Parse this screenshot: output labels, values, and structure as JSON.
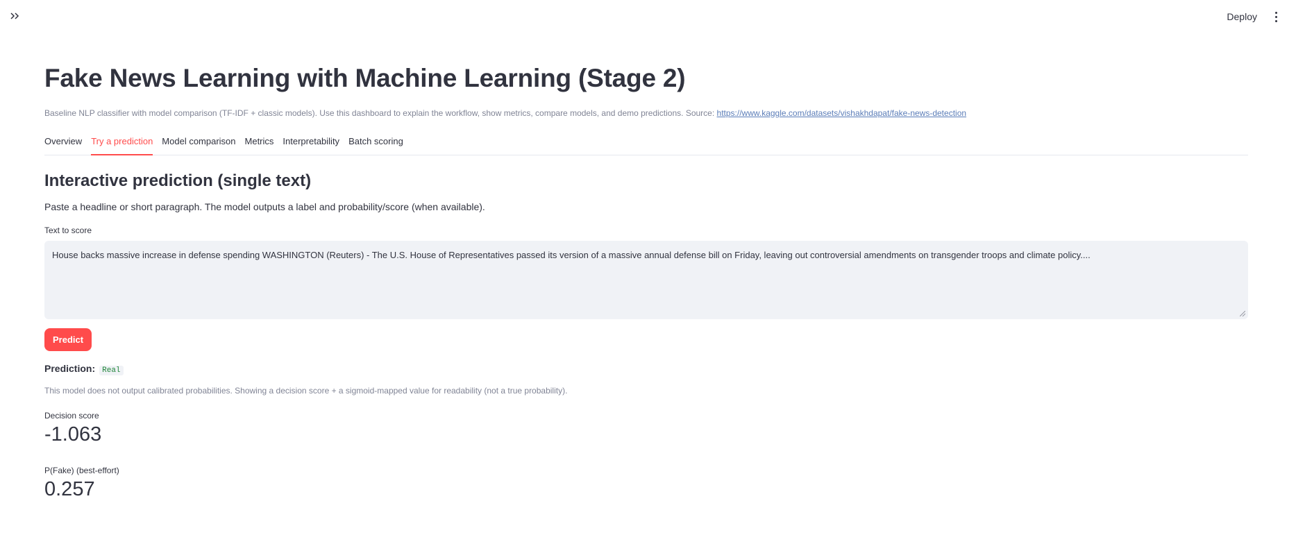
{
  "header": {
    "deploy_label": "Deploy"
  },
  "page": {
    "title": "Fake News Learning with Machine Learning (Stage 2)",
    "caption_text": "Baseline NLP classifier with model comparison (TF-IDF + classic models). Use this dashboard to explain the workflow, show metrics, compare models, and demo predictions. Source: ",
    "caption_link": "https://www.kaggle.com/datasets/vishakhdapat/fake-news-detection"
  },
  "tabs": [
    {
      "label": "Overview",
      "active": false
    },
    {
      "label": "Try a prediction",
      "active": true
    },
    {
      "label": "Model comparison",
      "active": false
    },
    {
      "label": "Metrics",
      "active": false
    },
    {
      "label": "Interpretability",
      "active": false
    },
    {
      "label": "Batch scoring",
      "active": false
    }
  ],
  "section": {
    "heading": "Interactive prediction (single text)",
    "description": "Paste a headline or short paragraph. The model outputs a label and probability/score (when available).",
    "field_label": "Text to score",
    "field_value": "House backs massive increase in defense spending WASHINGTON (Reuters) - The U.S. House of Representatives passed its version of a massive annual defense bill on Friday, leaving out controversial amendments on transgender troops and climate policy....",
    "predict_label": "Predict"
  },
  "result": {
    "prediction_label": "Prediction:",
    "prediction_value": "Real",
    "note": "This model does not output calibrated probabilities. Showing a decision score + a sigmoid-mapped value for readability (not a true probability).",
    "metrics": [
      {
        "label": "Decision score",
        "value": "-1.063"
      },
      {
        "label": "P(Fake) (best-effort)",
        "value": "0.257"
      }
    ]
  },
  "colors": {
    "accent": "#ff4b4b",
    "prediction_text": "#21863a",
    "input_bg": "#f0f2f6"
  },
  "icons": {
    "sidebar_toggle": "double-chevron-right-icon",
    "menu": "kebab-menu-icon"
  }
}
